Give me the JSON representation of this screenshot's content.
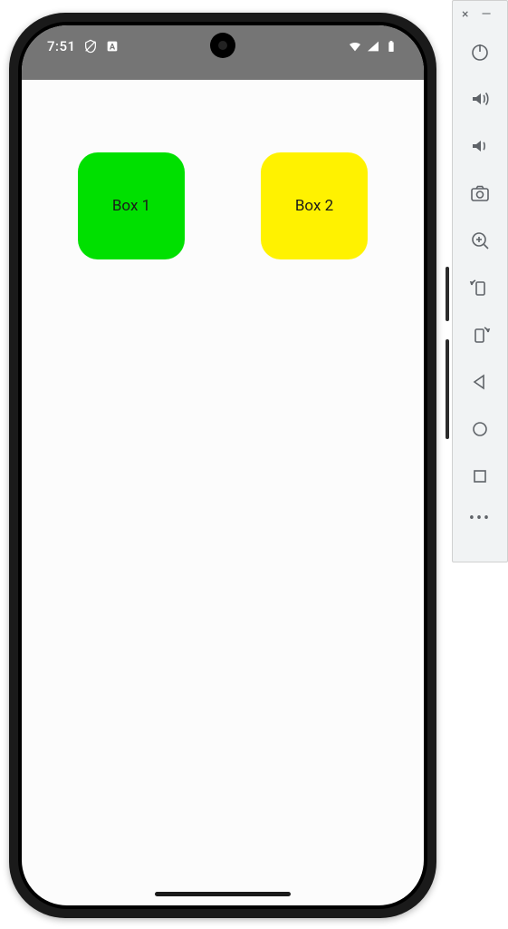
{
  "status_bar": {
    "time": "7:51",
    "icons_left": [
      "no-sim-icon",
      "alert-icon"
    ],
    "icons_right": [
      "wifi-icon",
      "signal-icon",
      "battery-icon"
    ]
  },
  "app": {
    "boxes": [
      {
        "label": "Box 1",
        "color": "#00e000"
      },
      {
        "label": "Box 2",
        "color": "#fff200"
      }
    ]
  },
  "emulator_toolbar": {
    "window_controls": {
      "close": "×",
      "minimize": "—"
    },
    "buttons": [
      "power",
      "volume-up",
      "volume-down",
      "screenshot",
      "zoom-in",
      "rotate-left",
      "rotate-right",
      "back",
      "home",
      "overview",
      "more"
    ]
  }
}
